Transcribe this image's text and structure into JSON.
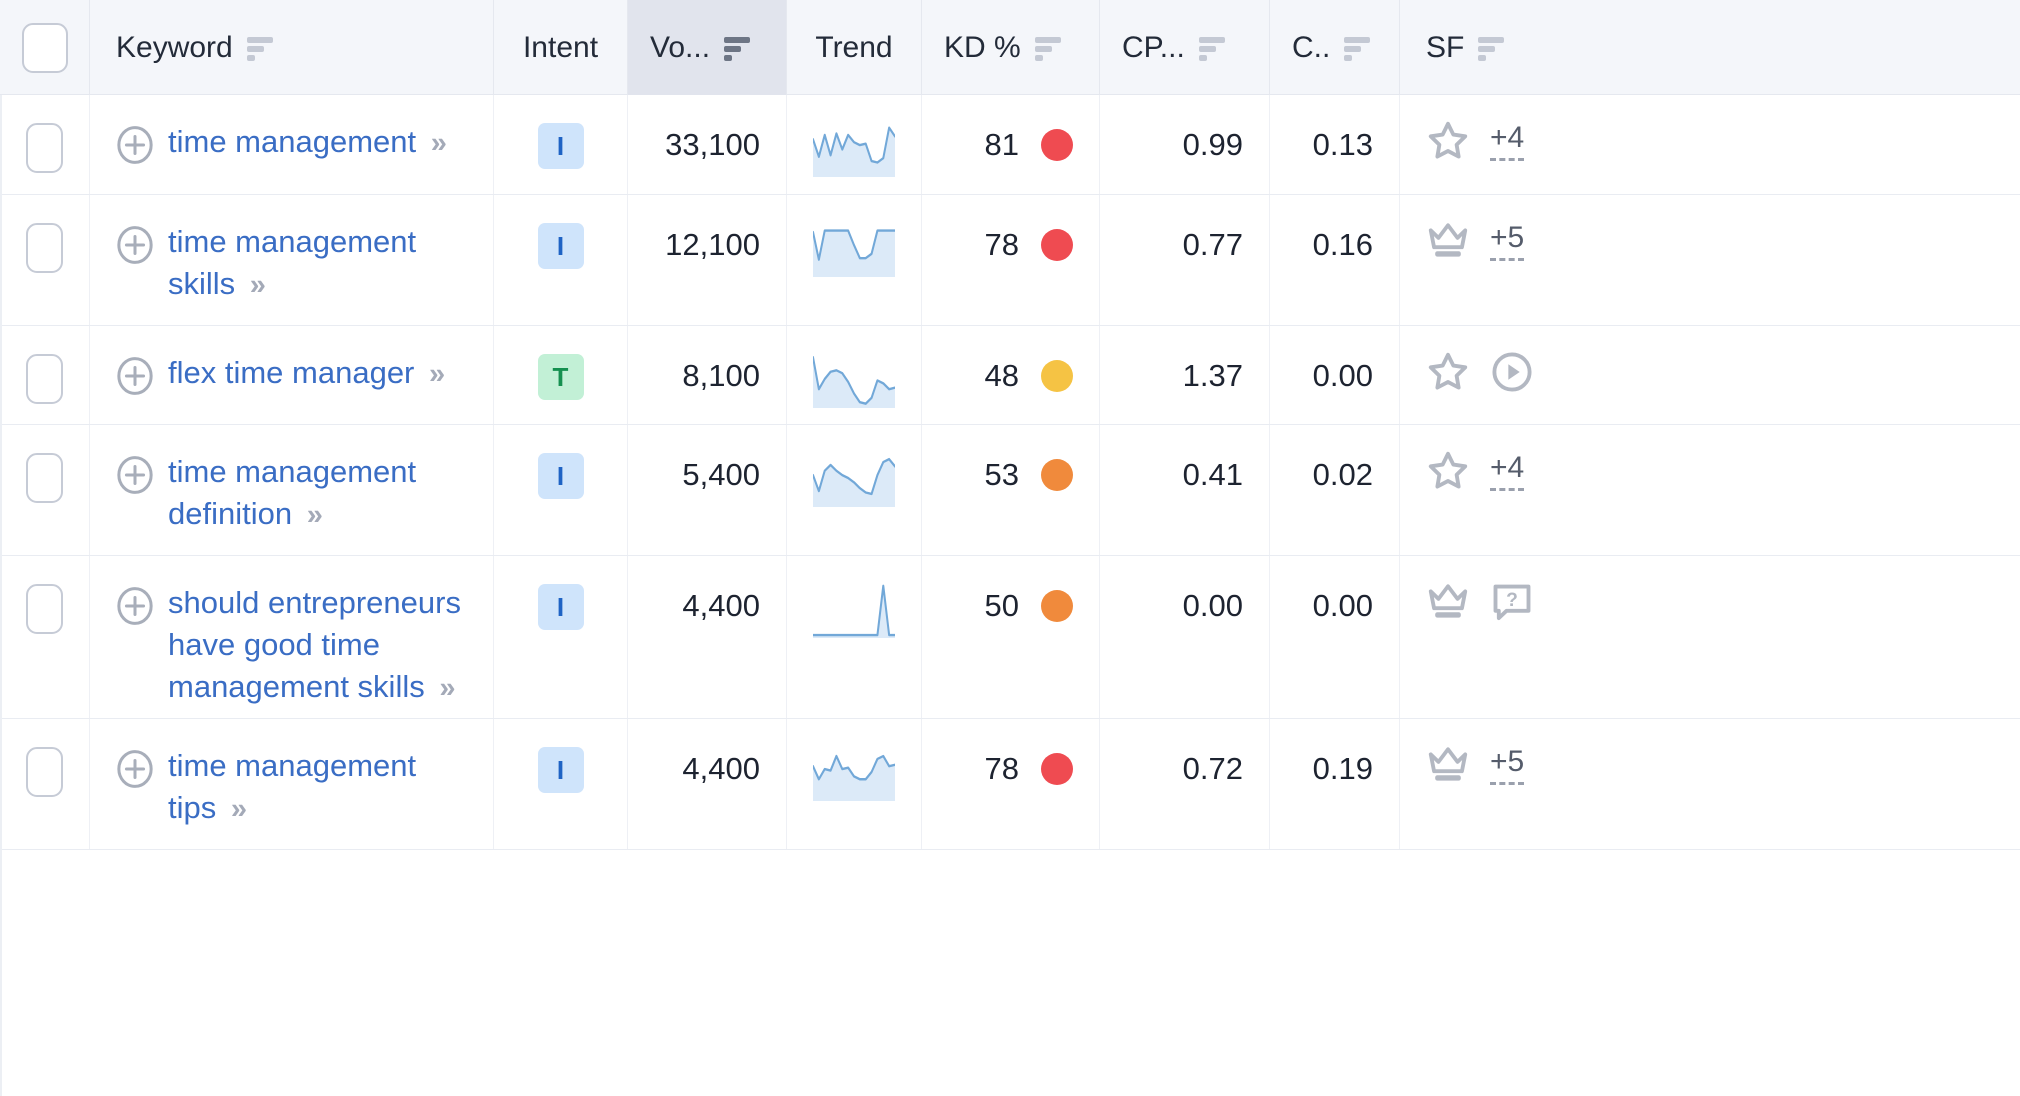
{
  "colors": {
    "link": "#3a6dc4",
    "header_bg": "#f4f6fa",
    "active_col_bg": "#e1e4ed",
    "kd_red": "#ef4b51",
    "kd_orange": "#f08a3c",
    "kd_yellow": "#f5c344",
    "spark_line": "#72a8d8",
    "spark_fill": "#dceaf8"
  },
  "header": {
    "select_all": "",
    "columns": [
      {
        "key": "check",
        "label": "",
        "sortable": false,
        "active": false,
        "align": "center"
      },
      {
        "key": "kw",
        "label": "Keyword",
        "sortable": true,
        "active": false,
        "align": "left"
      },
      {
        "key": "intent",
        "label": "Intent",
        "sortable": false,
        "active": false,
        "align": "center"
      },
      {
        "key": "vol",
        "label": "Vo...",
        "sortable": true,
        "active": true,
        "align": "left"
      },
      {
        "key": "trend",
        "label": "Trend",
        "sortable": false,
        "active": false,
        "align": "center"
      },
      {
        "key": "kd",
        "label": "KD %",
        "sortable": true,
        "active": false,
        "align": "left"
      },
      {
        "key": "cpc",
        "label": "CP...",
        "sortable": true,
        "active": false,
        "align": "left"
      },
      {
        "key": "com",
        "label": "C..",
        "sortable": true,
        "active": false,
        "align": "left"
      },
      {
        "key": "sf",
        "label": "SF",
        "sortable": true,
        "active": false,
        "align": "left"
      }
    ]
  },
  "rows": [
    {
      "keyword": "time management",
      "intent": {
        "letter": "I",
        "type": "i"
      },
      "volume": "33,100",
      "trend": [
        52,
        28,
        58,
        30,
        60,
        38,
        58,
        48,
        44,
        46,
        22,
        20,
        26,
        68,
        56
      ],
      "kd": "81",
      "kd_color": "#ef4b51",
      "cpc": "0.99",
      "com": "0.13",
      "sf_icons": [
        "star-icon"
      ],
      "sf_more": "+4"
    },
    {
      "keyword": "time management skills",
      "intent": {
        "letter": "I",
        "type": "i"
      },
      "volume": "12,100",
      "trend": [
        62,
        24,
        64,
        64,
        64,
        64,
        64,
        44,
        26,
        26,
        32,
        64,
        64,
        64,
        64
      ],
      "kd": "78",
      "kd_color": "#ef4b51",
      "cpc": "0.77",
      "com": "0.16",
      "sf_icons": [
        "crown-icon"
      ],
      "sf_more": "+5"
    },
    {
      "keyword": "flex time manager",
      "intent": {
        "letter": "T",
        "type": "t"
      },
      "volume": "8,100",
      "trend": [
        70,
        26,
        40,
        50,
        52,
        48,
        36,
        20,
        8,
        6,
        14,
        38,
        34,
        26,
        28
      ],
      "kd": "48",
      "kd_color": "#f5c344",
      "cpc": "1.37",
      "com": "0.00",
      "sf_icons": [
        "star-icon",
        "video-icon"
      ],
      "sf_more": ""
    },
    {
      "keyword": "time management definition",
      "intent": {
        "letter": "I",
        "type": "i"
      },
      "volume": "5,400",
      "trend": [
        44,
        22,
        50,
        58,
        50,
        44,
        40,
        34,
        26,
        20,
        18,
        44,
        62,
        66,
        56
      ],
      "kd": "53",
      "kd_color": "#f08a3c",
      "cpc": "0.41",
      "com": "0.02",
      "sf_icons": [
        "star-icon"
      ],
      "sf_more": "+4"
    },
    {
      "keyword": "should entrepreneurs have good time management skills",
      "intent": {
        "letter": "I",
        "type": "i"
      },
      "volume": "4,400",
      "trend": [
        4,
        4,
        4,
        4,
        4,
        4,
        4,
        4,
        4,
        4,
        4,
        4,
        72,
        4,
        4
      ],
      "kd": "50",
      "kd_color": "#f08a3c",
      "cpc": "0.00",
      "com": "0.00",
      "sf_icons": [
        "crown-icon",
        "question-bubble-icon"
      ],
      "sf_more": ""
    },
    {
      "keyword": "time management tips",
      "intent": {
        "letter": "I",
        "type": "i"
      },
      "volume": "4,400",
      "trend": [
        48,
        30,
        44,
        42,
        62,
        44,
        46,
        34,
        30,
        30,
        40,
        58,
        62,
        48,
        50
      ],
      "kd": "78",
      "kd_color": "#ef4b51",
      "cpc": "0.72",
      "com": "0.19",
      "sf_icons": [
        "crown-icon"
      ],
      "sf_more": "+5"
    }
  ],
  "glyphs": {
    "chevron_double": "»"
  }
}
